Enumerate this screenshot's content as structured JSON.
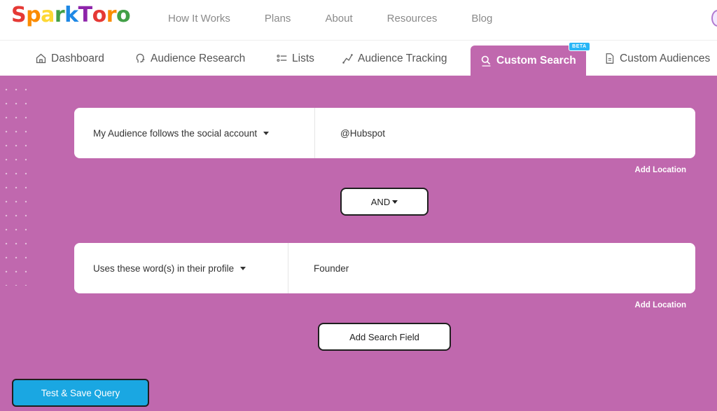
{
  "brand": {
    "logo_text": "SparkToro"
  },
  "top_nav": [
    "How It Works",
    "Plans",
    "About",
    "Resources",
    "Blog"
  ],
  "tabs": {
    "dashboard": "Dashboard",
    "audience_research": "Audience Research",
    "lists": "Lists",
    "audience_tracking": "Audience Tracking",
    "custom_search": "Custom Search",
    "custom_search_badge": "BETA",
    "custom_audiences": "Custom Audiences"
  },
  "query": {
    "row1": {
      "selector": "My Audience follows the social account",
      "value": "@Hubspot",
      "add_location": "Add Location"
    },
    "operator": "AND",
    "row2": {
      "selector": "Uses these word(s) in their profile",
      "value": "Founder",
      "add_location": "Add Location"
    },
    "add_field_label": "Add Search Field"
  },
  "actions": {
    "test_save": "Test & Save Query"
  },
  "colors": {
    "panel_bg": "#c068ae",
    "primary_button": "#1aa7e2",
    "badge": "#29b6f6"
  }
}
